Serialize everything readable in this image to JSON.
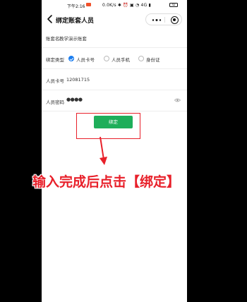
{
  "status_bar": {
    "time": "下午2:16",
    "right_text": "0.0K/s ✱ ⏰ ▣ ◔ 4G ▮"
  },
  "nav": {
    "title": "绑定账套人员"
  },
  "form": {
    "account_set": {
      "label": "账套名",
      "value": "教学演示账套"
    },
    "bind_type": {
      "label": "绑定类型",
      "options": [
        {
          "label": "人员卡号",
          "checked": true
        },
        {
          "label": "人员手机",
          "checked": false
        },
        {
          "label": "身份证",
          "checked": false
        }
      ]
    },
    "card_number": {
      "label": "人员卡号",
      "value": "12081715"
    },
    "password": {
      "label": "人员密码",
      "value": "●●●●"
    }
  },
  "bind_button": {
    "label": "绑定"
  },
  "annotation": {
    "text": "输入完成后点击【绑定】"
  },
  "colors": {
    "primary_green": "#1eae5a",
    "radio_blue": "#1a7df0",
    "annotation_red": "#e8202a",
    "recording_orange": "#f0502a"
  },
  "battery": {
    "level": "42"
  }
}
